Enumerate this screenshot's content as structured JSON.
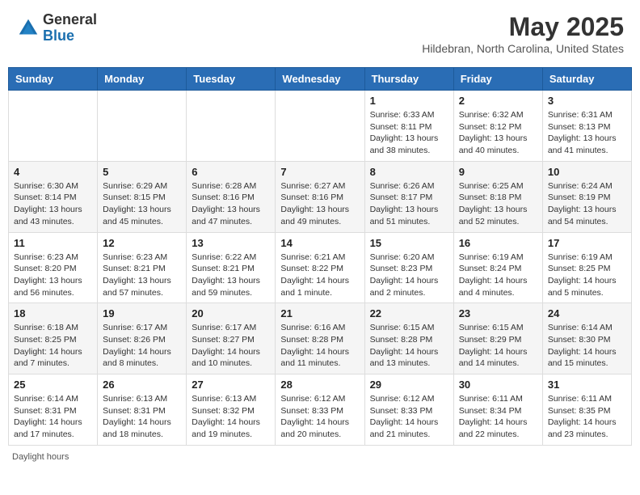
{
  "header": {
    "logo_general": "General",
    "logo_blue": "Blue",
    "month_title": "May 2025",
    "location": "Hildebran, North Carolina, United States"
  },
  "footer": {
    "daylight_label": "Daylight hours"
  },
  "days_of_week": [
    "Sunday",
    "Monday",
    "Tuesday",
    "Wednesday",
    "Thursday",
    "Friday",
    "Saturday"
  ],
  "weeks": [
    {
      "days": [
        {
          "num": "",
          "info": ""
        },
        {
          "num": "",
          "info": ""
        },
        {
          "num": "",
          "info": ""
        },
        {
          "num": "",
          "info": ""
        },
        {
          "num": "1",
          "info": "Sunrise: 6:33 AM\nSunset: 8:11 PM\nDaylight: 13 hours\nand 38 minutes."
        },
        {
          "num": "2",
          "info": "Sunrise: 6:32 AM\nSunset: 8:12 PM\nDaylight: 13 hours\nand 40 minutes."
        },
        {
          "num": "3",
          "info": "Sunrise: 6:31 AM\nSunset: 8:13 PM\nDaylight: 13 hours\nand 41 minutes."
        }
      ]
    },
    {
      "days": [
        {
          "num": "4",
          "info": "Sunrise: 6:30 AM\nSunset: 8:14 PM\nDaylight: 13 hours\nand 43 minutes."
        },
        {
          "num": "5",
          "info": "Sunrise: 6:29 AM\nSunset: 8:15 PM\nDaylight: 13 hours\nand 45 minutes."
        },
        {
          "num": "6",
          "info": "Sunrise: 6:28 AM\nSunset: 8:16 PM\nDaylight: 13 hours\nand 47 minutes."
        },
        {
          "num": "7",
          "info": "Sunrise: 6:27 AM\nSunset: 8:16 PM\nDaylight: 13 hours\nand 49 minutes."
        },
        {
          "num": "8",
          "info": "Sunrise: 6:26 AM\nSunset: 8:17 PM\nDaylight: 13 hours\nand 51 minutes."
        },
        {
          "num": "9",
          "info": "Sunrise: 6:25 AM\nSunset: 8:18 PM\nDaylight: 13 hours\nand 52 minutes."
        },
        {
          "num": "10",
          "info": "Sunrise: 6:24 AM\nSunset: 8:19 PM\nDaylight: 13 hours\nand 54 minutes."
        }
      ]
    },
    {
      "days": [
        {
          "num": "11",
          "info": "Sunrise: 6:23 AM\nSunset: 8:20 PM\nDaylight: 13 hours\nand 56 minutes."
        },
        {
          "num": "12",
          "info": "Sunrise: 6:23 AM\nSunset: 8:21 PM\nDaylight: 13 hours\nand 57 minutes."
        },
        {
          "num": "13",
          "info": "Sunrise: 6:22 AM\nSunset: 8:21 PM\nDaylight: 13 hours\nand 59 minutes."
        },
        {
          "num": "14",
          "info": "Sunrise: 6:21 AM\nSunset: 8:22 PM\nDaylight: 14 hours\nand 1 minute."
        },
        {
          "num": "15",
          "info": "Sunrise: 6:20 AM\nSunset: 8:23 PM\nDaylight: 14 hours\nand 2 minutes."
        },
        {
          "num": "16",
          "info": "Sunrise: 6:19 AM\nSunset: 8:24 PM\nDaylight: 14 hours\nand 4 minutes."
        },
        {
          "num": "17",
          "info": "Sunrise: 6:19 AM\nSunset: 8:25 PM\nDaylight: 14 hours\nand 5 minutes."
        }
      ]
    },
    {
      "days": [
        {
          "num": "18",
          "info": "Sunrise: 6:18 AM\nSunset: 8:25 PM\nDaylight: 14 hours\nand 7 minutes."
        },
        {
          "num": "19",
          "info": "Sunrise: 6:17 AM\nSunset: 8:26 PM\nDaylight: 14 hours\nand 8 minutes."
        },
        {
          "num": "20",
          "info": "Sunrise: 6:17 AM\nSunset: 8:27 PM\nDaylight: 14 hours\nand 10 minutes."
        },
        {
          "num": "21",
          "info": "Sunrise: 6:16 AM\nSunset: 8:28 PM\nDaylight: 14 hours\nand 11 minutes."
        },
        {
          "num": "22",
          "info": "Sunrise: 6:15 AM\nSunset: 8:28 PM\nDaylight: 14 hours\nand 13 minutes."
        },
        {
          "num": "23",
          "info": "Sunrise: 6:15 AM\nSunset: 8:29 PM\nDaylight: 14 hours\nand 14 minutes."
        },
        {
          "num": "24",
          "info": "Sunrise: 6:14 AM\nSunset: 8:30 PM\nDaylight: 14 hours\nand 15 minutes."
        }
      ]
    },
    {
      "days": [
        {
          "num": "25",
          "info": "Sunrise: 6:14 AM\nSunset: 8:31 PM\nDaylight: 14 hours\nand 17 minutes."
        },
        {
          "num": "26",
          "info": "Sunrise: 6:13 AM\nSunset: 8:31 PM\nDaylight: 14 hours\nand 18 minutes."
        },
        {
          "num": "27",
          "info": "Sunrise: 6:13 AM\nSunset: 8:32 PM\nDaylight: 14 hours\nand 19 minutes."
        },
        {
          "num": "28",
          "info": "Sunrise: 6:12 AM\nSunset: 8:33 PM\nDaylight: 14 hours\nand 20 minutes."
        },
        {
          "num": "29",
          "info": "Sunrise: 6:12 AM\nSunset: 8:33 PM\nDaylight: 14 hours\nand 21 minutes."
        },
        {
          "num": "30",
          "info": "Sunrise: 6:11 AM\nSunset: 8:34 PM\nDaylight: 14 hours\nand 22 minutes."
        },
        {
          "num": "31",
          "info": "Sunrise: 6:11 AM\nSunset: 8:35 PM\nDaylight: 14 hours\nand 23 minutes."
        }
      ]
    }
  ]
}
